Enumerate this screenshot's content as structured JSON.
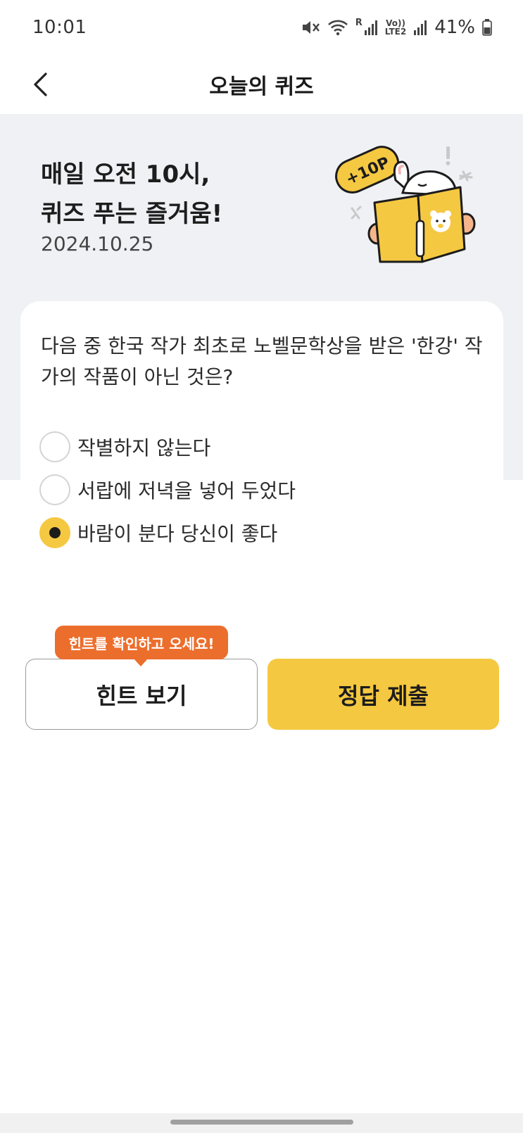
{
  "status_bar": {
    "time": "10:01",
    "network_label_top": "Vo))",
    "network_label_bottom": "LTE2",
    "roaming_label": "R",
    "battery_percent": "41%"
  },
  "header": {
    "title": "오늘의 퀴즈"
  },
  "hero": {
    "title_line1": "매일 오전 10시,",
    "title_line2": "퀴즈 푸는 즐거움!",
    "date": "2024.10.25",
    "points_badge": "+10P"
  },
  "quiz": {
    "question": "다음 중 한국 작가 최초로 노벨문학상을 받은 '한강' 작가의 작품이 아닌 것은?",
    "options": [
      {
        "label": "작별하지 않는다",
        "selected": false
      },
      {
        "label": "서랍에 저녁을 넣어 두었다",
        "selected": false
      },
      {
        "label": "바람이 분다 당신이 좋다",
        "selected": true
      }
    ]
  },
  "actions": {
    "hint_tooltip": "힌트를 확인하고 오세요!",
    "hint_button": "힌트 보기",
    "submit_button": "정답 제출"
  },
  "colors": {
    "accent_yellow": "#f5c842",
    "tooltip_orange": "#ec6e2c",
    "hero_background": "#eff1f5"
  }
}
